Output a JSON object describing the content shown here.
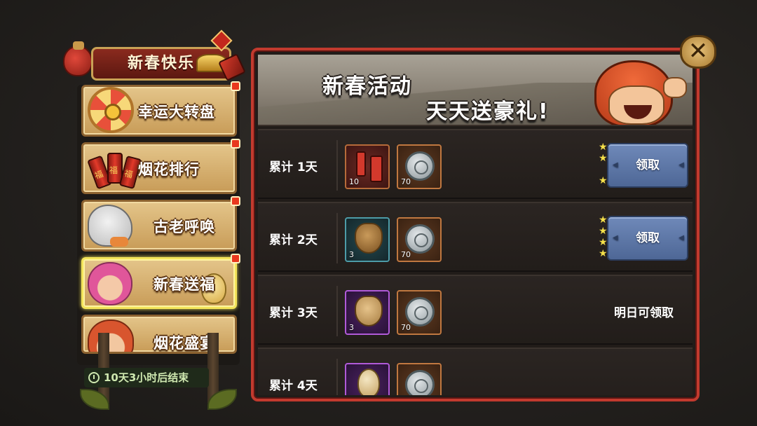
{
  "sidebar": {
    "title": "新春快乐",
    "items": [
      {
        "label": "幸运大转盘",
        "active": false,
        "icon": "wheel-icon"
      },
      {
        "label": "烟花排行",
        "active": false,
        "icon": "firecracker-icon"
      },
      {
        "label": "古老呼唤",
        "active": false,
        "icon": "beast-icon"
      },
      {
        "label": "新春送福",
        "active": true,
        "icon": "girl-avatar-icon"
      },
      {
        "label": "烟花盛宴",
        "active": false,
        "icon": "hero-avatar-icon"
      }
    ],
    "countdown": "10天3小时后结束"
  },
  "header": {
    "line1": "新春活动",
    "line2": "天天送豪礼!"
  },
  "close_label": "✕",
  "rows": [
    {
      "day": "累计 1天",
      "items": [
        {
          "qty": "10",
          "icon": "firecracker-icon"
        },
        {
          "qty": "70",
          "icon": "silver-coin-icon"
        }
      ],
      "status": "领取",
      "state": "claimable"
    },
    {
      "day": "累计 2天",
      "items": [
        {
          "qty": "3",
          "icon": "pouch-icon"
        },
        {
          "qty": "70",
          "icon": "silver-coin-icon"
        }
      ],
      "status": "领取",
      "state": "claimable"
    },
    {
      "day": "累计 3天",
      "items": [
        {
          "qty": "3",
          "icon": "sack-icon"
        },
        {
          "qty": "70",
          "icon": "silver-coin-icon"
        }
      ],
      "status": "明日可领取",
      "state": "tomorrow"
    },
    {
      "day": "累计 4天",
      "items": [
        {
          "qty": "",
          "icon": "egg-icon"
        },
        {
          "qty": "",
          "icon": "silver-coin-icon"
        }
      ],
      "status": "",
      "state": "locked"
    }
  ],
  "colors": {
    "panel_border": "#c23a2e",
    "claim_button": "#5b76a8",
    "star": "#f5e04a",
    "menu_item": "#d9b477",
    "active_outline": "#f3e45a"
  }
}
